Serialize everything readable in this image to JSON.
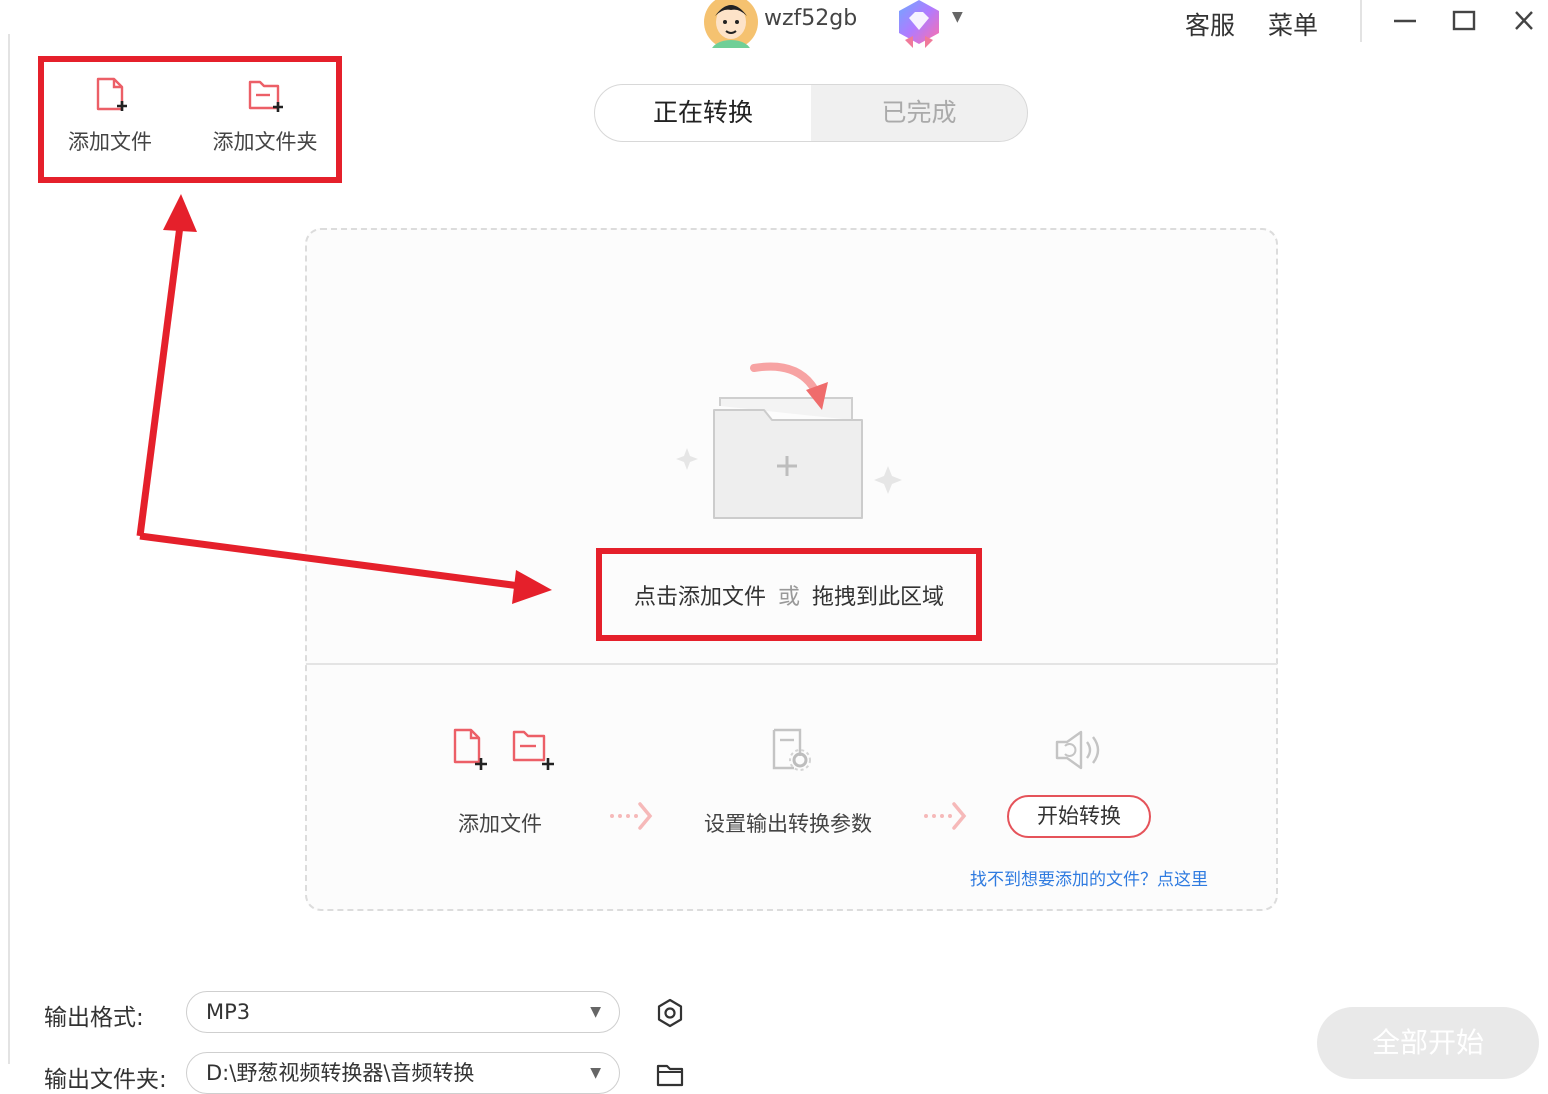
{
  "header": {
    "username": "wzf52gb",
    "support_label": "客服",
    "menu_label": "菜单"
  },
  "toolbar": {
    "add_file_label": "添加文件",
    "add_folder_label": "添加文件夹"
  },
  "tabs": {
    "converting": "正在转换",
    "completed": "已完成"
  },
  "dropzone": {
    "click_add": "点击添加文件",
    "or": "或",
    "drag_here": "拖拽到此区域"
  },
  "steps": {
    "add_file": "添加文件",
    "set_params": "设置输出转换参数",
    "start": "开始转换"
  },
  "help_link": "找不到想要添加的文件？点这里",
  "output": {
    "format_label": "输出格式:",
    "format_value": "MP3",
    "folder_label": "输出文件夹:",
    "folder_value": "D:\\野葱视频转换器\\音频转换"
  },
  "start_all": "全部开始",
  "colors": {
    "accent_red": "#e5535a",
    "annotation_red": "#e5202b",
    "link_blue": "#2f7be0"
  }
}
